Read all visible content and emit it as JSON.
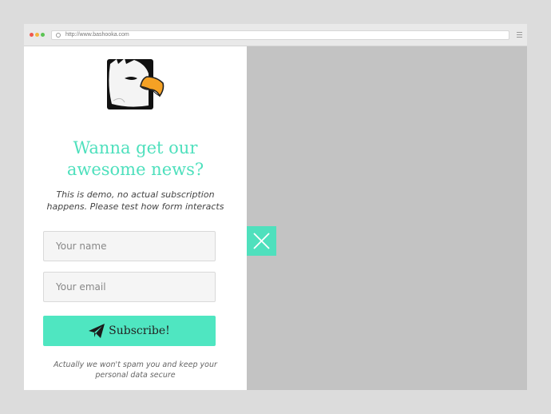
{
  "browser": {
    "url": "http://www.bashooka.com"
  },
  "form": {
    "title_line1": "Wanna get our",
    "title_line2": "awesome news?",
    "description": "This is demo, no actual subscription happens. Please test how form interacts",
    "name_placeholder": "Your name",
    "email_placeholder": "Your email",
    "subscribe_label": "Subscribe!",
    "note": "Actually we won't spam you and keep your personal data secure"
  },
  "icons": {
    "logo": "eagle-logo-icon",
    "subscribe": "paper-plane-icon",
    "close": "close-icon"
  },
  "colors": {
    "accent": "#4fe0bd",
    "button": "#4fe6c1",
    "backdrop": "#c3c3c3"
  }
}
